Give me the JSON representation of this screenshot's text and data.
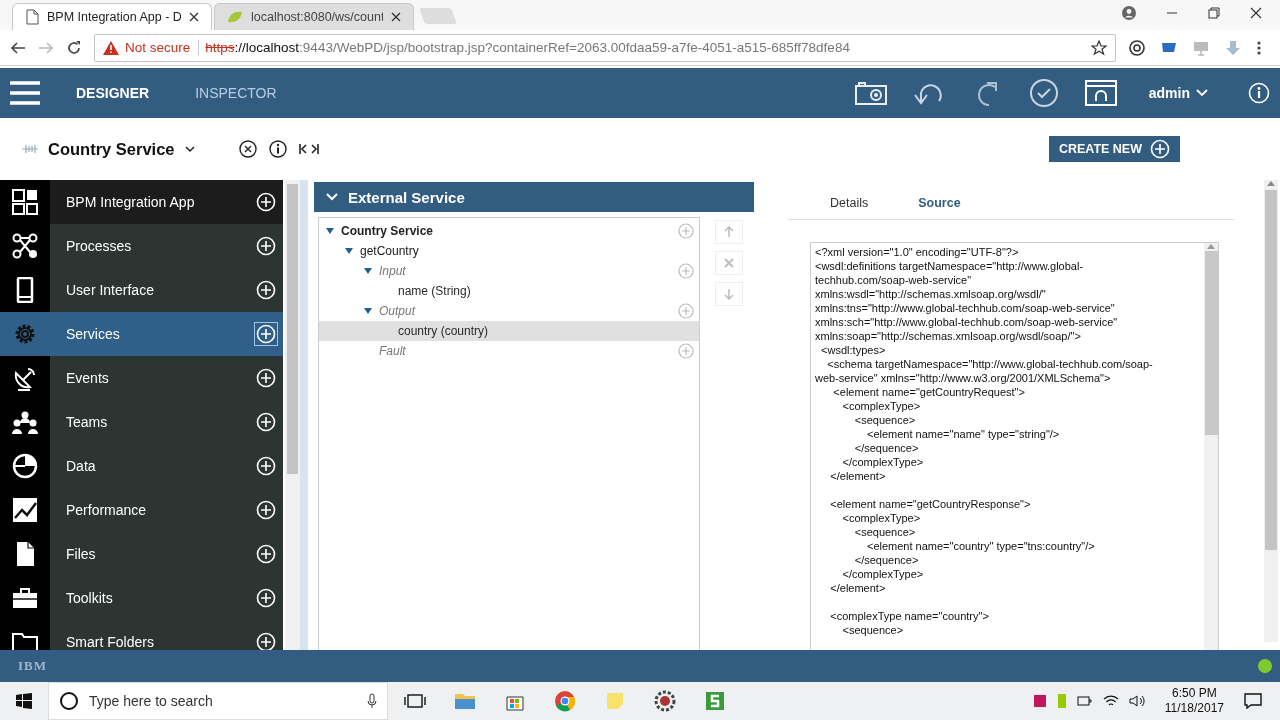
{
  "browser": {
    "tabs": [
      {
        "title": "BPM Integration App - D",
        "selected": true
      },
      {
        "title": "localhost:8080/ws/count",
        "selected": false
      }
    ],
    "security": "Not secure",
    "url_scheme": "https",
    "url_host": "://localhost",
    "url_rest": ":9443/WebPD/jsp/bootstrap.jsp?containerRef=2063.00fdaa59-a7fe-4051-a515-685ff78dfe84"
  },
  "header": {
    "tabs": [
      {
        "label": "DESIGNER",
        "selected": true
      },
      {
        "label": "INSPECTOR",
        "selected": false
      }
    ],
    "user": "admin"
  },
  "artifact": {
    "title": "Country Service",
    "button": "CREATE NEW"
  },
  "sidebar": {
    "items": [
      {
        "label": "BPM Integration App",
        "kind": "app",
        "selected": false
      },
      {
        "label": "Processes",
        "kind": "processes",
        "selected": false
      },
      {
        "label": "User Interface",
        "kind": "ui",
        "selected": false
      },
      {
        "label": "Services",
        "kind": "services",
        "selected": true
      },
      {
        "label": "Events",
        "kind": "events",
        "selected": false
      },
      {
        "label": "Teams",
        "kind": "teams",
        "selected": false
      },
      {
        "label": "Data",
        "kind": "data",
        "selected": false
      },
      {
        "label": "Performance",
        "kind": "performance",
        "selected": false
      },
      {
        "label": "Files",
        "kind": "files",
        "selected": false
      },
      {
        "label": "Toolkits",
        "kind": "toolkits",
        "selected": false
      },
      {
        "label": "Smart Folders",
        "kind": "folders",
        "selected": false
      }
    ]
  },
  "editor": {
    "title": "External Service",
    "tree": [
      {
        "label": "Country Service",
        "kind": "service",
        "expanded": true,
        "addable": true,
        "selected": false,
        "children": [
          {
            "label": "getCountry",
            "kind": "operation",
            "expanded": true,
            "addable": false,
            "selected": false,
            "children": [
              {
                "label": "Input",
                "kind": "group",
                "expanded": true,
                "addable": true,
                "selected": false,
                "children": [
                  {
                    "label": "name (String)",
                    "kind": "field",
                    "addable": false,
                    "selected": false
                  }
                ]
              },
              {
                "label": "Output",
                "kind": "group",
                "expanded": true,
                "addable": true,
                "selected": false,
                "children": [
                  {
                    "label": "country (country)",
                    "kind": "field",
                    "addable": false,
                    "selected": true
                  }
                ]
              },
              {
                "label": "Fault",
                "kind": "group",
                "addable": true,
                "selected": false
              }
            ]
          }
        ]
      }
    ]
  },
  "source": {
    "tabs": [
      {
        "label": "Details",
        "selected": false
      },
      {
        "label": "Source",
        "selected": true
      }
    ],
    "blocks": [
      [
        "<?xml version=\"1.0\" encoding=\"UTF-8\"?>",
        "<wsdl:definitions targetNamespace=\"http://www.global-",
        "techhub.com/soap-web-service\"",
        "xmlns:wsdl=\"http://schemas.xmlsoap.org/wsdl/\"",
        "xmlns:tns=\"http://www.global-techhub.com/soap-web-service\"",
        "xmlns:sch=\"http://www.global-techhub.com/soap-web-service\"",
        "xmlns:soap=\"http://schemas.xmlsoap.org/wsdl/soap/\">",
        "  <wsdl:types>",
        "    <schema targetNamespace=\"http://www.global-techhub.com/soap-",
        "web-service\" xmlns=\"http://www.w3.org/2001/XMLSchema\">",
        "      <element name=\"getCountryRequest\">",
        "         <complexType>",
        "             <sequence>",
        "                 <element name=\"name\" type=\"string\"/>",
        "             </sequence>",
        "         </complexType>",
        "     </element>"
      ],
      [
        "     <element name=\"getCountryResponse\">",
        "         <complexType>",
        "             <sequence>",
        "                 <element name=\"country\" type=\"tns:country\"/>",
        "             </sequence>",
        "         </complexType>",
        "     </element>"
      ],
      [
        "     <complexType name=\"country\">",
        "         <sequence>"
      ]
    ]
  },
  "status_bar": {
    "logo": "IBM"
  },
  "taskbar": {
    "search_placeholder": "Type here to search",
    "time": "6:50 PM",
    "date": "11/18/2017"
  }
}
